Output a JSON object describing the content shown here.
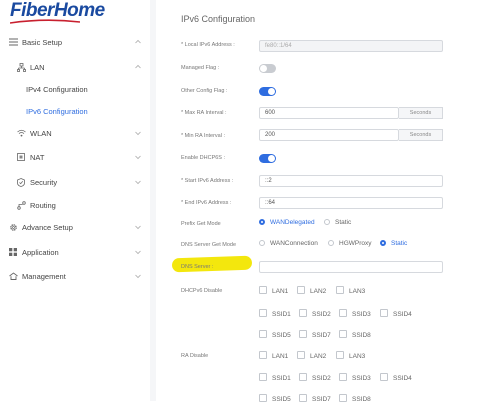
{
  "brand": {
    "logo_text": "FiberHome"
  },
  "sidebar": {
    "items": [
      {
        "label": "Basic Setup",
        "icon": "menu-lines-icon"
      },
      {
        "label": "LAN",
        "icon": "lan-network-icon"
      },
      {
        "label": "IPv4 Configuration"
      },
      {
        "label": "IPv6 Configuration"
      },
      {
        "label": "WLAN",
        "icon": "wifi-icon"
      },
      {
        "label": "NAT",
        "icon": "nat-box-icon"
      },
      {
        "label": "Security",
        "icon": "shield-icon"
      },
      {
        "label": "Routing",
        "icon": "routing-icon"
      },
      {
        "label": "Advance Setup",
        "icon": "gear-icon"
      },
      {
        "label": "Application",
        "icon": "grid-apps-icon"
      },
      {
        "label": "Management",
        "icon": "management-icon"
      }
    ]
  },
  "page": {
    "title": "IPv6 Configuration"
  },
  "form": {
    "local_ipv6": {
      "label": "* Local IPv6 Address :",
      "value": "fe80::1/64"
    },
    "managed_flag": {
      "label": "Managed Flag :",
      "state": "off"
    },
    "other_config_flag": {
      "label": "Other Config Flag :",
      "state": "on"
    },
    "max_ra": {
      "label": "* Max RA Interval :",
      "value": "600",
      "unit": "Seconds"
    },
    "min_ra": {
      "label": "* Min RA Interval :",
      "value": "200",
      "unit": "Seconds"
    },
    "enable_dhcp6s": {
      "label": "Enable DHCP6S :",
      "state": "on"
    },
    "start_ipv6": {
      "label": "* Start IPv6 Address :",
      "value": "::2"
    },
    "end_ipv6": {
      "label": "* End IPv6 Address :",
      "value": "::64"
    },
    "prefix_get_mode": {
      "label": "Prefix Get Mode",
      "options": [
        "WANDelegated",
        "Static"
      ],
      "selected": "WANDelegated"
    },
    "dns_server_get_mode": {
      "label": "DNS Server Get Mode",
      "options": [
        "WANConnection",
        "HGWProxy",
        "Static"
      ],
      "selected": "Static"
    },
    "dns_server": {
      "label": "DNS Server :",
      "value": ""
    },
    "dhcpv6_disable": {
      "label": "DHCPv6 Disable",
      "rows": [
        [
          "LAN1",
          "LAN2",
          "LAN3"
        ],
        [
          "SSID1",
          "SSID2",
          "SSID3",
          "SSID4"
        ],
        [
          "SSID5",
          "SSID7",
          "SSID8"
        ]
      ]
    },
    "ra_disable": {
      "label": "RA Disable",
      "rows": [
        [
          "LAN1",
          "LAN2",
          "LAN3"
        ],
        [
          "SSID1",
          "SSID2",
          "SSID3",
          "SSID4"
        ],
        [
          "SSID5",
          "SSID7",
          "SSID8"
        ]
      ]
    }
  },
  "colors": {
    "accent": "#2f6de0",
    "brand": "#1a4aa0",
    "highlight": "#f2e600"
  }
}
